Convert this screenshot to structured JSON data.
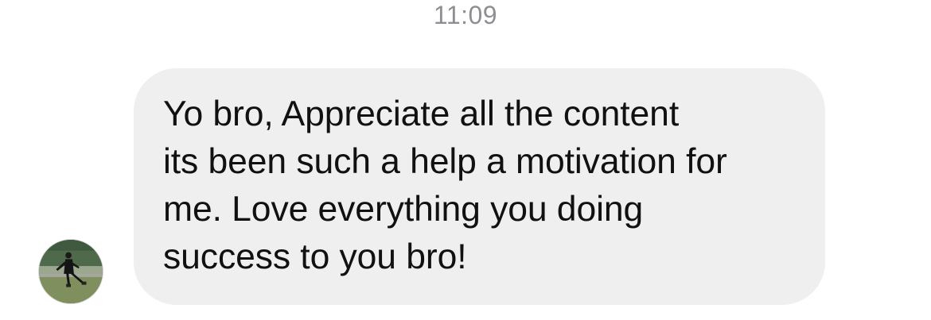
{
  "thread": {
    "timestamp": "11:09"
  },
  "message": {
    "text": "Yo bro, Appreciate all the content\nits been such a help a motivation for\nme. Love everything you doing\nsuccess to you bro!",
    "bubble_color": "#efefef",
    "text_color": "#111111"
  },
  "sender": {
    "avatar_icon": "profile-photo-icon"
  },
  "colors": {
    "timestamp": "#8e8e93",
    "background": "#ffffff"
  }
}
